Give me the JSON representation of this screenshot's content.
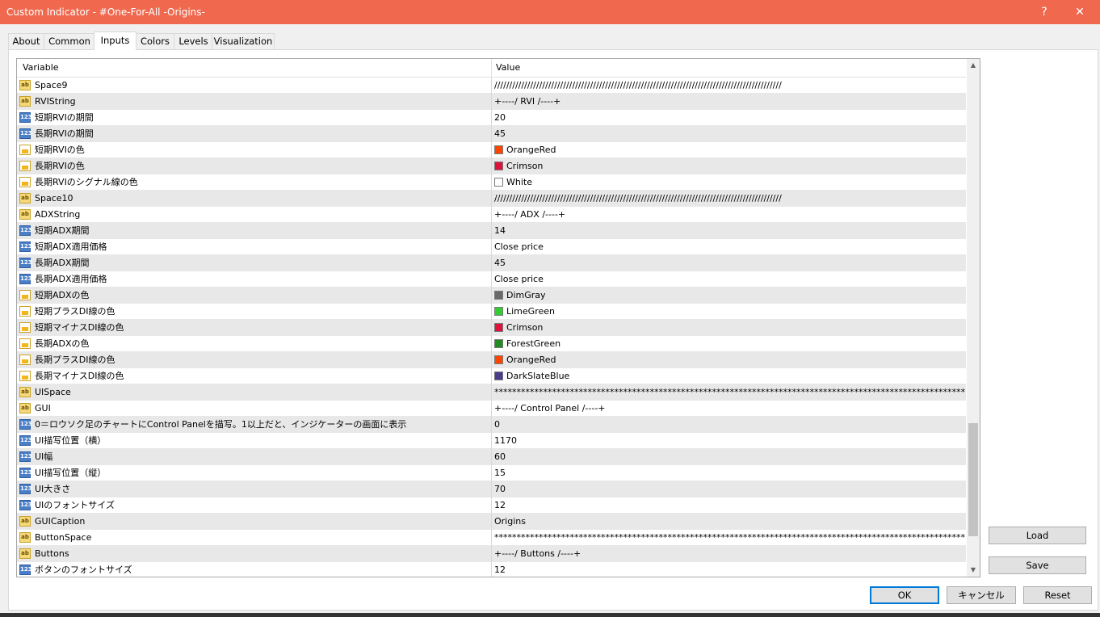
{
  "window": {
    "title": "Custom Indicator - #One-For-All -Origins-",
    "help": "?",
    "close": "✕"
  },
  "tabs": [
    "About",
    "Common",
    "Inputs",
    "Colors",
    "Levels",
    "Visualization"
  ],
  "grid": {
    "headers": {
      "variable": "Variable",
      "value": "Value"
    },
    "rows": [
      {
        "type": "ab",
        "name": "Space9",
        "value": "////////////////////////////////////////////////////////////////////////////////////////////////"
      },
      {
        "type": "ab",
        "name": "RVIString",
        "value": "+----/ RVI /----+"
      },
      {
        "type": "num",
        "name": "短期RVIの期間",
        "value": "20"
      },
      {
        "type": "num",
        "name": "長期RVIの期間",
        "value": "45"
      },
      {
        "type": "color",
        "name": "短期RVIの色",
        "value": "OrangeRed",
        "swatch": "#ff4500"
      },
      {
        "type": "color",
        "name": "長期RVIの色",
        "value": "Crimson",
        "swatch": "#dc143c"
      },
      {
        "type": "color",
        "name": "長期RVIのシグナル線の色",
        "value": "White",
        "swatch": "#ffffff"
      },
      {
        "type": "ab",
        "name": "Space10",
        "value": "////////////////////////////////////////////////////////////////////////////////////////////////"
      },
      {
        "type": "ab",
        "name": "ADXString",
        "value": "+----/ ADX /----+"
      },
      {
        "type": "num",
        "name": "短期ADX期間",
        "value": "14"
      },
      {
        "type": "num",
        "name": "短期ADX適用価格",
        "value": "Close price"
      },
      {
        "type": "num",
        "name": "長期ADX期間",
        "value": "45"
      },
      {
        "type": "num",
        "name": "長期ADX適用価格",
        "value": "Close price"
      },
      {
        "type": "color",
        "name": "短期ADXの色",
        "value": "DimGray",
        "swatch": "#696969"
      },
      {
        "type": "color",
        "name": "短期プラスDI線の色",
        "value": "LimeGreen",
        "swatch": "#32cd32"
      },
      {
        "type": "color",
        "name": "短期マイナスDI線の色",
        "value": "Crimson",
        "swatch": "#dc143c"
      },
      {
        "type": "color",
        "name": "長期ADXの色",
        "value": "ForestGreen",
        "swatch": "#228b22"
      },
      {
        "type": "color",
        "name": "長期プラスDI線の色",
        "value": "OrangeRed",
        "swatch": "#ff4500"
      },
      {
        "type": "color",
        "name": "長期マイナスDI線の色",
        "value": "DarkSlateBlue",
        "swatch": "#483d8b"
      },
      {
        "type": "ab",
        "name": "UISpace",
        "value": "**********************************************************************************************************"
      },
      {
        "type": "ab",
        "name": "GUI",
        "value": "+----/ Control Panel /----+"
      },
      {
        "type": "num",
        "name": "0＝ロウソク足のチャートにControl Panelを描写。1以上だと、インジケーターの画面に表示",
        "value": "0"
      },
      {
        "type": "num",
        "name": "UI描写位置（横）",
        "value": "1170"
      },
      {
        "type": "num",
        "name": "UI幅",
        "value": "60"
      },
      {
        "type": "num",
        "name": "UI描写位置（縦）",
        "value": "15"
      },
      {
        "type": "num",
        "name": "UI大きさ",
        "value": "70"
      },
      {
        "type": "num",
        "name": "UIのフォントサイズ",
        "value": "12"
      },
      {
        "type": "ab",
        "name": "GUICaption",
        "value": "Origins"
      },
      {
        "type": "ab",
        "name": "ButtonSpace",
        "value": "**********************************************************************************************************"
      },
      {
        "type": "ab",
        "name": "Buttons",
        "value": "+----/ Buttons /----+"
      },
      {
        "type": "num",
        "name": "ボタンのフォントサイズ",
        "value": "12"
      }
    ]
  },
  "buttons": {
    "load": "Load",
    "save": "Save",
    "ok": "OK",
    "cancel": "キャンセル",
    "reset": "Reset"
  },
  "icons": {
    "ab": "ab",
    "num": "123"
  }
}
